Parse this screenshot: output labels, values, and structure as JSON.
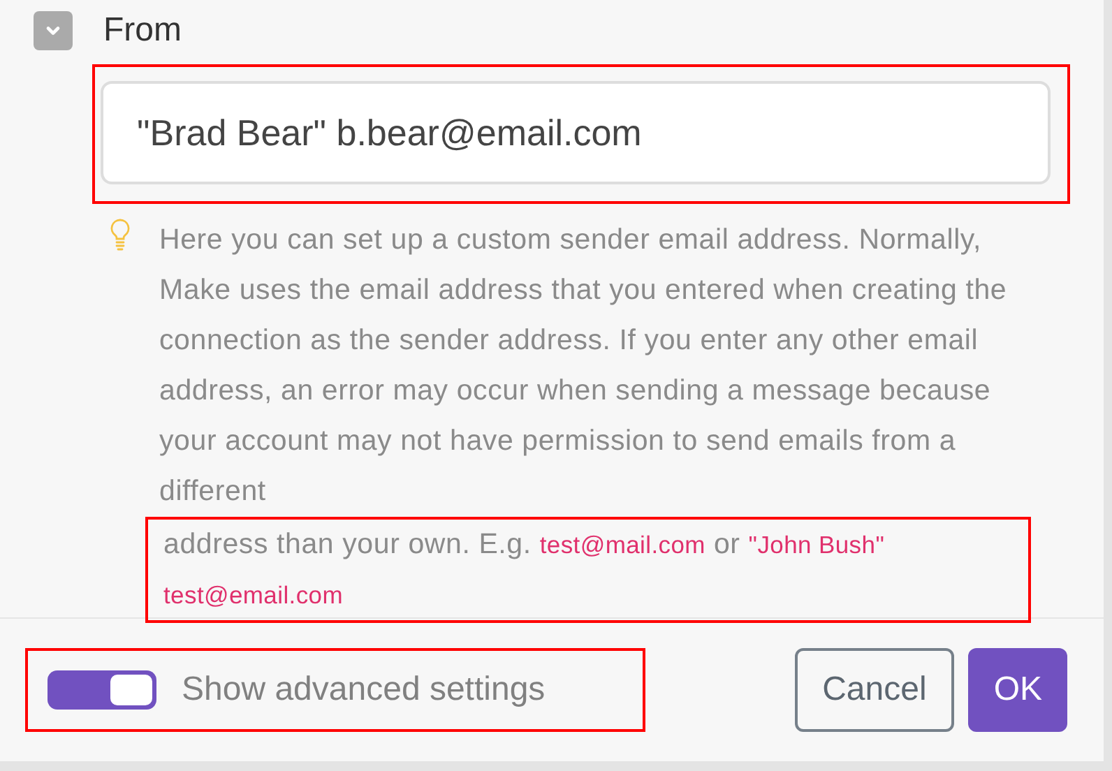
{
  "field": {
    "label": "From",
    "expanded": true,
    "value": "\"Brad Bear\" b.bear@email.com"
  },
  "hint": {
    "text": "Here you can set up a custom sender email address. Normally, Make uses the email address that you entered when creating the connection as the sender address. If you enter any other email address, an error may occur when sending a message because your account may not have permission to send emails from a different",
    "highlighted": [
      {
        "kind": "text",
        "text": "address than your own. E.g. "
      },
      {
        "kind": "example",
        "text": "test@mail.com"
      },
      {
        "kind": "text",
        "text": " or "
      },
      {
        "kind": "example",
        "text": "\"John Bush\" test@email.com"
      }
    ]
  },
  "footer": {
    "toggle": {
      "label": "Show advanced settings",
      "on": true
    },
    "buttons": [
      {
        "kind": "secondary",
        "label": "Cancel"
      },
      {
        "kind": "primary",
        "label": "OK"
      }
    ]
  }
}
